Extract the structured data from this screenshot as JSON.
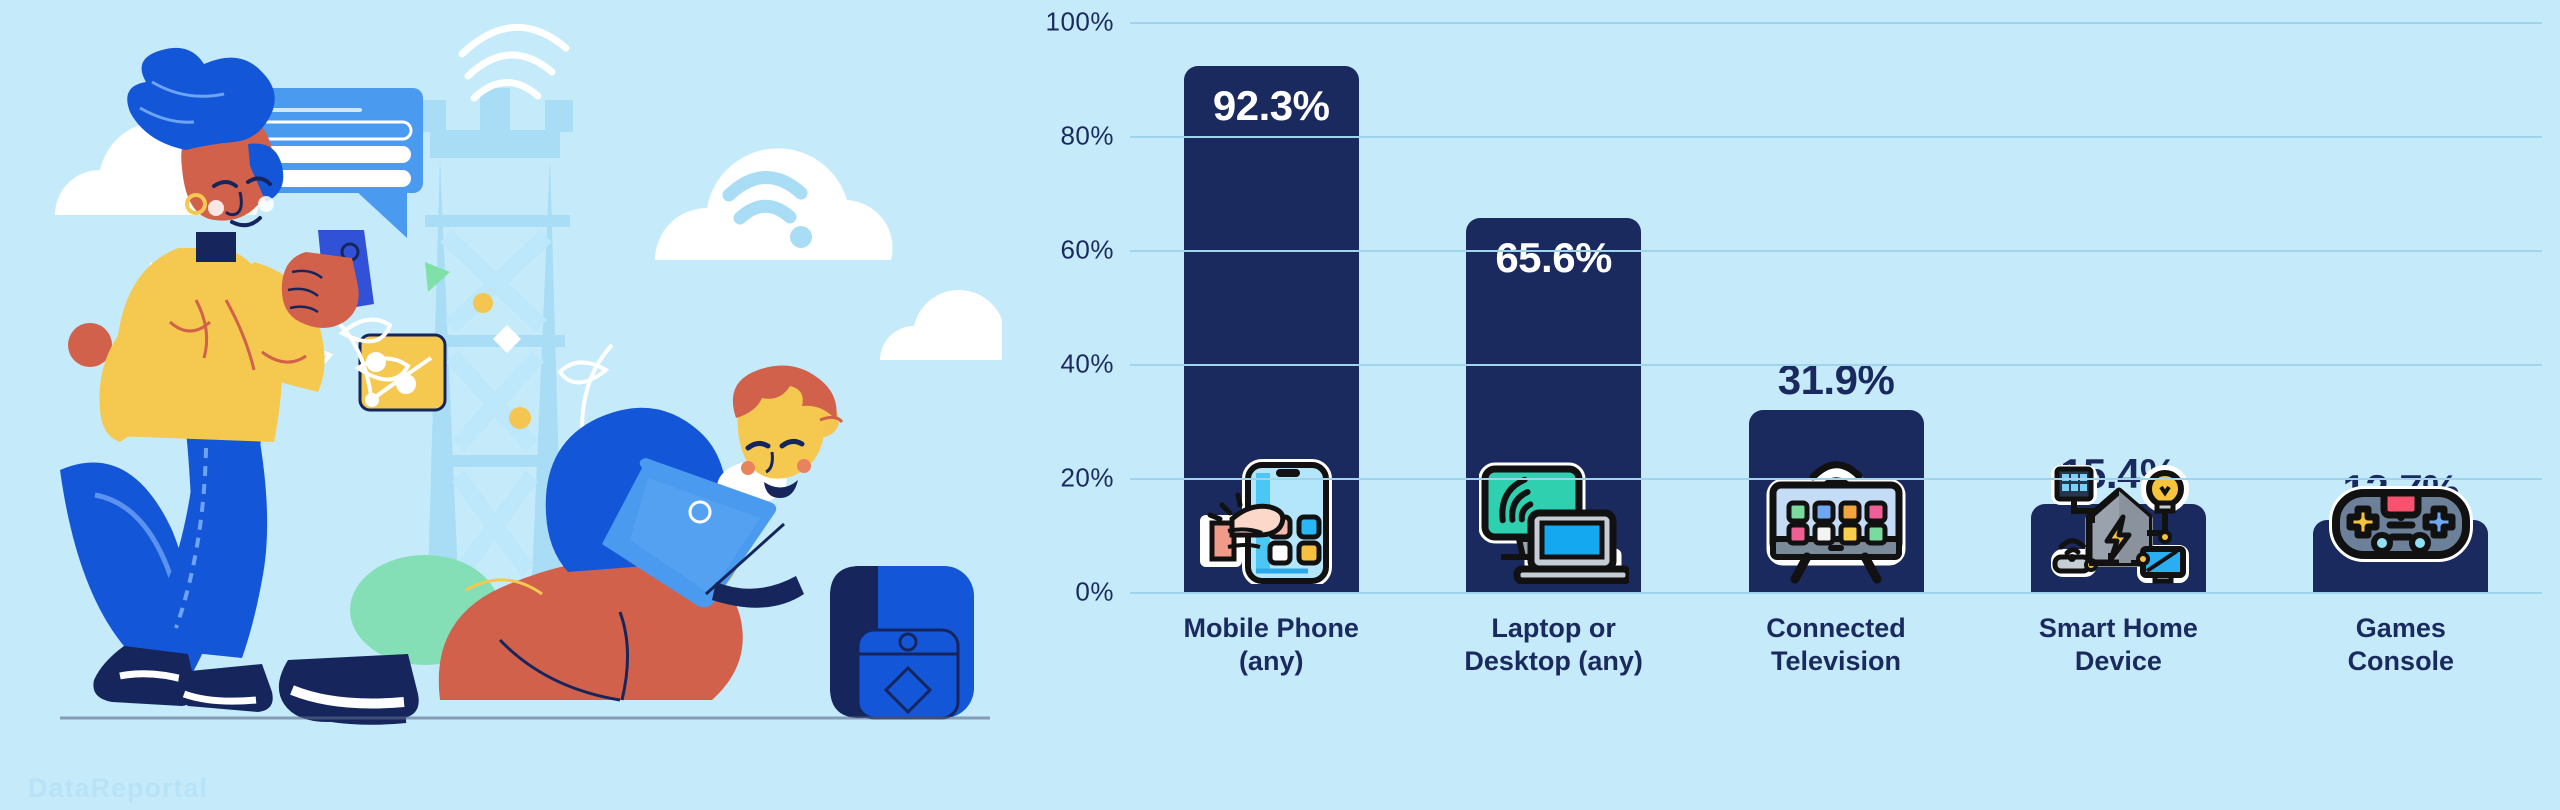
{
  "background_color": "#c5ebfb",
  "bar_color": "#1b2a5e",
  "text_color": "#1b2a5e",
  "gridline_color": "#9fd4ea",
  "illustration": {
    "alt": "people using mobile phone and laptop near a cell tower",
    "elements": [
      "chat-bubble",
      "cell-tower",
      "cloud",
      "wifi-cloud",
      "woman-with-phone",
      "man-with-laptop",
      "backpack",
      "network-icon-tile",
      "leaf",
      "confetti-shapes"
    ]
  },
  "watermark": "DataReportal",
  "chart_data": {
    "type": "bar",
    "title": "",
    "subtitle": "",
    "xlabel": "",
    "ylabel": "",
    "ylim": [
      0,
      100
    ],
    "grid": true,
    "legend": "none",
    "categories": [
      "Mobile Phone\n(any)",
      "Laptop or\nDesktop (any)",
      "Connected\nTelevision",
      "Smart Home\nDevice",
      "Games\nConsole"
    ],
    "values": [
      92.3,
      65.6,
      31.9,
      15.4,
      12.7
    ],
    "value_labels": [
      "92.3%",
      "65.6%",
      "31.9%",
      "15.4%",
      "12.7%"
    ],
    "label_position": [
      "inside",
      "inside",
      "above",
      "above",
      "above"
    ],
    "ytick_labels": [
      "100%",
      "80%",
      "60%",
      "40%",
      "20%",
      "0%"
    ],
    "ytick_values": [
      100,
      80,
      60,
      40,
      20,
      0
    ],
    "bar_icons": [
      "mobile-phone-in-hand-icon",
      "laptop-and-monitor-icon",
      "connected-television-icon",
      "smart-home-device-icon",
      "games-console-icon"
    ]
  },
  "categories": [
    {
      "line1": "Mobile Phone",
      "line2": "(any)"
    },
    {
      "line1": "Laptop or",
      "line2": "Desktop (any)"
    },
    {
      "line1": "Connected",
      "line2": "Television"
    },
    {
      "line1": "Smart Home",
      "line2": "Device"
    },
    {
      "line1": "Games",
      "line2": "Console"
    }
  ]
}
